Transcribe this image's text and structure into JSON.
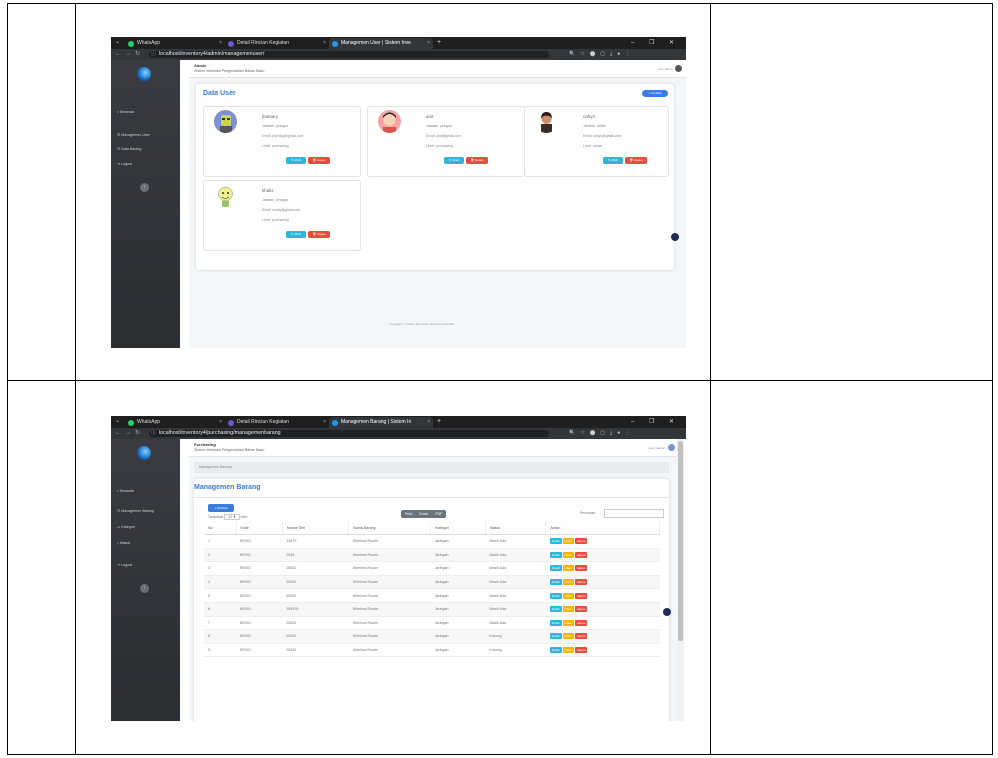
{
  "browser": {
    "tabs": [
      "WhatsApp",
      "Detail Rincian Kegiatan"
    ],
    "icons": [
      "back-icon",
      "forward-icon",
      "reload-icon",
      "info-icon",
      "zoom-icon",
      "star-icon",
      "extension-icon",
      "download-icon",
      "profile-icon",
      "menu-icon"
    ]
  },
  "shot1": {
    "active_tab": "Managemen User | Sistem Inve",
    "url": "localhost/inventory4/admin/managemenuser/",
    "role": "Admin",
    "system_name": "Sistem Informasi Pengendalian Bahan Baku",
    "greeting": "Hey, admin",
    "sidebar": [
      "Beranda",
      "Managemen User",
      "Data Barang",
      "Logout"
    ],
    "title": "Data User",
    "add_button": "+ Tambah",
    "edit_label": "Ubah",
    "delete_label": "Hapus",
    "users": [
      {
        "name": "jhamary",
        "jabatan": "Jabatan: petugas",
        "email": "Email: jhamary@gmail.com",
        "level": "Level: purchasing"
      },
      {
        "name": "anit",
        "jabatan": "Jabatan: petugas",
        "email": "Email: anit@gmail.com",
        "level": "Level: purchasing"
      },
      {
        "name": "cahyo",
        "jabatan": "Jabatan: admin",
        "email": "Email: cahyo@gmail.com",
        "level": "Level: admin"
      },
      {
        "name": "khalis",
        "jabatan": "Jabatan: petugas",
        "email": "Email: khalis@gmail.com",
        "level": "Level: purchasing"
      }
    ],
    "footer": "Copyright © Sistem Informasi Inventory Ketoeflik"
  },
  "shot2": {
    "active_tab": "Managemen Barang | Sistem In",
    "url": "localhost/inventory4/purchasing/managemenbarang",
    "role": "Purchasing",
    "system_name": "Sistem Informasi Pengendalian Bahan Baku",
    "greeting": "Hey, jhamary",
    "sidebar": [
      "Beranda",
      "Managemen Barang",
      "Kategori",
      "Masuk",
      "Logout"
    ],
    "breadcrumb": "Managemen Barang",
    "title": "Managemen Barang",
    "add_button": "+ Tambah",
    "show_label": "Tampilkan",
    "show_value": "10",
    "entries_label": "entri",
    "export_buttons": [
      "Print",
      "Excel",
      "PDF"
    ],
    "search_label": "Pencarian:",
    "columns": [
      "No",
      "Kode",
      "Nomor Seri",
      "Nama Barang",
      "Kategori",
      "Status",
      "Action"
    ],
    "rows": [
      [
        "1",
        "BR001",
        "14879",
        "Wireless Router",
        "Jaringan",
        "Masih Ada"
      ],
      [
        "2",
        "BR001",
        "2548",
        "Wireless Router",
        "Jaringan",
        "Masih Ada"
      ],
      [
        "3",
        "BR001",
        "25632",
        "Wireless Router",
        "Jaringan",
        "Masih Ada"
      ],
      [
        "4",
        "BR001",
        "25632",
        "Wireless Router",
        "Jaringan",
        "Masih Ada"
      ],
      [
        "5",
        "BR001",
        "25632",
        "Wireless Router",
        "Jaringan",
        "Masih Ada"
      ],
      [
        "6",
        "BR001",
        "365478",
        "Wireless Router",
        "Jaringan",
        "Masih Ada"
      ],
      [
        "7",
        "BR001",
        "25632",
        "Wireless Router",
        "Jaringan",
        "Masih Ada"
      ],
      [
        "8",
        "BR001",
        "25632",
        "Wireless Router",
        "Jaringan",
        "Kosong"
      ],
      [
        "9",
        "BR001",
        "25632",
        "Wireless Router",
        "Jaringan",
        "Kosong"
      ]
    ],
    "action_buttons": [
      "Detail",
      "Ubah",
      "Hapus"
    ]
  }
}
